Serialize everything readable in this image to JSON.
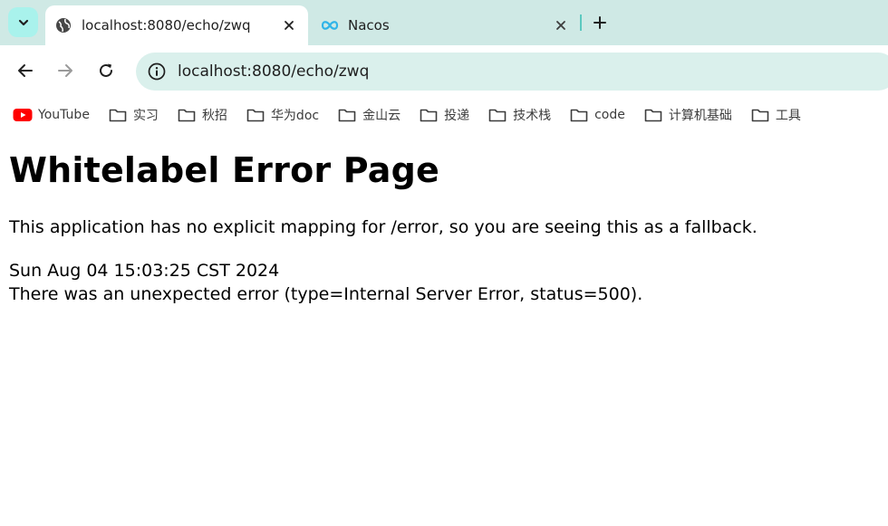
{
  "tabs": [
    {
      "title": "localhost:8080/echo/zwq",
      "active": true,
      "favicon": "globe-icon"
    },
    {
      "title": "Nacos",
      "active": false,
      "favicon": "infinity-icon"
    }
  ],
  "toolbar": {
    "url": "localhost:8080/echo/zwq"
  },
  "bookmarks": [
    {
      "label": "YouTube",
      "icon": "youtube-icon"
    },
    {
      "label": "实习",
      "icon": "folder-icon"
    },
    {
      "label": "秋招",
      "icon": "folder-icon"
    },
    {
      "label": "华为doc",
      "icon": "folder-icon"
    },
    {
      "label": "金山云",
      "icon": "folder-icon"
    },
    {
      "label": "投递",
      "icon": "folder-icon"
    },
    {
      "label": "技术栈",
      "icon": "folder-icon"
    },
    {
      "label": "code",
      "icon": "folder-icon"
    },
    {
      "label": "计算机基础",
      "icon": "folder-icon"
    },
    {
      "label": "工具",
      "icon": "folder-icon"
    }
  ],
  "page": {
    "heading": "Whitelabel Error Page",
    "message": "This application has no explicit mapping for /error, so you are seeing this as a fallback.",
    "timestamp": "Sun Aug 04 15:03:25 CST 2024",
    "error": "There was an unexpected error (type=Internal Server Error, status=500)."
  },
  "colors": {
    "tabstrip": "#cfe9e5",
    "omnibox": "#daf0ec",
    "accent": "#5cc9c0",
    "youtube": "#ff0000"
  }
}
